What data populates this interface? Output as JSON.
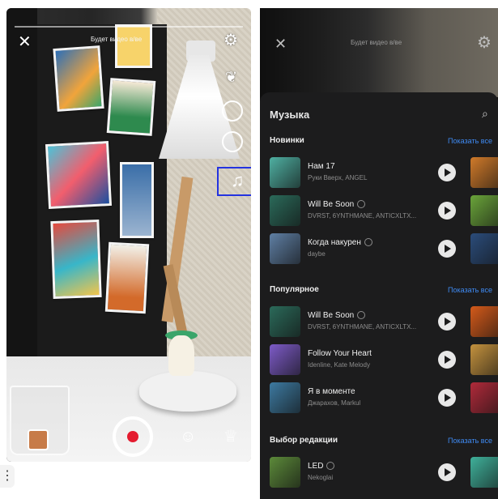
{
  "left_screen": {
    "top_hint": "Будет видео в/ве",
    "close_icon": "close-icon",
    "settings_icon": "gear-icon",
    "music_icon": "music-note-icon"
  },
  "right_screen": {
    "top_hint": "Будет видео в/ве",
    "sheet_title": "Музыка",
    "sections": [
      {
        "title": "Новинки",
        "link": "Показать все",
        "tracks": [
          {
            "title": "Нам 17",
            "artist": "Руки Вверх, ANGEL",
            "cover": "#4fb0a2",
            "peek": "#d07a2a",
            "info": false
          },
          {
            "title": "Will Be Soon",
            "artist": "DVRST, 6YNTHMANE, ANTICXLTX...",
            "cover": "#2b6a5a",
            "peek": "#6aa43a",
            "info": true
          },
          {
            "title": "Когда накурен",
            "artist": "daybe",
            "cover": "#5f7fa4",
            "peek": "#2b4c7a",
            "info": true
          }
        ]
      },
      {
        "title": "Популярное",
        "link": "Показать все",
        "tracks": [
          {
            "title": "Will Be Soon",
            "artist": "DVRST, 6YNTHMANE, ANTICXLTX...",
            "cover": "#2b6a5a",
            "peek": "#d45a1a",
            "info": true
          },
          {
            "title": "Follow Your Heart",
            "artist": "Idenline, Kate Melody",
            "cover": "#7d5bc8",
            "peek": "#c4923e",
            "info": false
          },
          {
            "title": "Я в моменте",
            "artist": "Джарахов, Markul",
            "cover": "#3d7aa1",
            "peek": "#b02a3a",
            "info": false
          }
        ]
      },
      {
        "title": "Выбор редакции",
        "link": "Показать все",
        "tracks": [
          {
            "title": "LED",
            "artist": "Nekoglai",
            "cover": "#5c8a3a",
            "peek": "#3fb09a",
            "info": true
          }
        ]
      }
    ]
  }
}
